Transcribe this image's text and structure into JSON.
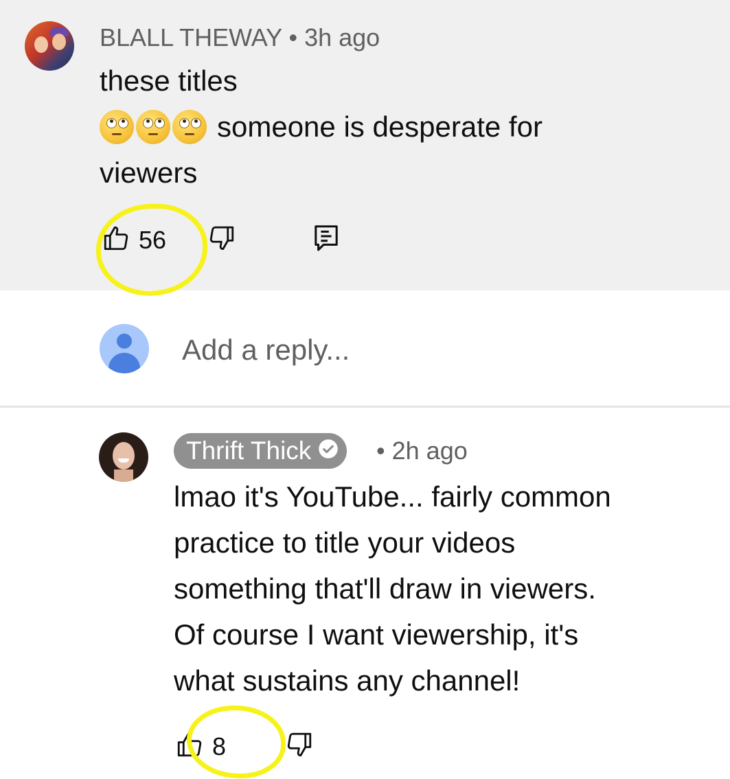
{
  "top_comment": {
    "author": "BLALL THEWAY",
    "separator": "•",
    "time": "3h ago",
    "text_line1": "these titles",
    "text_line2_suffix": "someone is desperate for",
    "text_line3": "viewers",
    "emoji_name": "face-with-rolling-eyes",
    "emoji_count": 3,
    "like_count": "56"
  },
  "reply_box": {
    "placeholder": "Add a reply..."
  },
  "reply_comment": {
    "author": "Thrift Thick",
    "verified": true,
    "separator": "•",
    "time": "2h ago",
    "text_lines": [
      "lmao it's YouTube... fairly common",
      "practice to title your videos",
      "something that'll draw in viewers.",
      "Of course I want viewership, it's",
      "what sustains any channel!"
    ],
    "like_count": "8"
  },
  "colors": {
    "highlight_bg": "#f0f0f0",
    "annotation_yellow": "#f6f21a",
    "creator_pill": "#909090",
    "secondary_text": "#606060"
  },
  "icons": [
    "like-icon",
    "dislike-icon",
    "reply-icon",
    "verified-check-icon",
    "default-avatar-icon"
  ]
}
